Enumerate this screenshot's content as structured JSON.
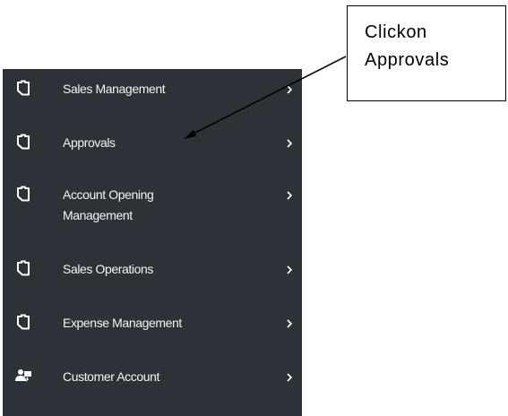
{
  "sidebar": {
    "items": [
      {
        "label": "Sales Management",
        "icon": "clipboard-icon"
      },
      {
        "label": "Approvals",
        "icon": "clipboard-icon"
      },
      {
        "label_line1": "Account Opening",
        "label_line2": "Management",
        "icon": "clipboard-icon"
      },
      {
        "label": "Sales Operations",
        "icon": "clipboard-icon"
      },
      {
        "label": "Expense Management",
        "icon": "clipboard-icon"
      },
      {
        "label": "Customer Account",
        "icon": "customer-account-icon"
      }
    ],
    "background": "#2c3237",
    "text_color": "#f3f4f5"
  },
  "callout": {
    "line1": "Clickon",
    "line2": "Approvals"
  }
}
